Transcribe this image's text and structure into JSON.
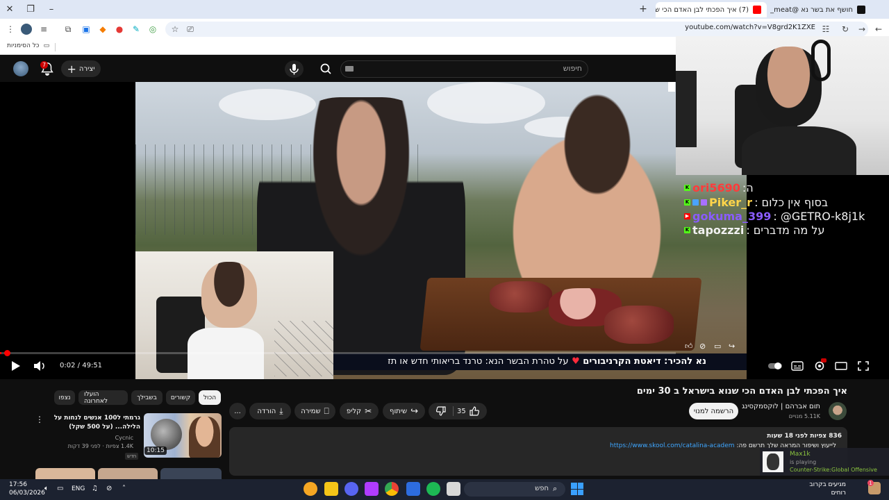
{
  "browser": {
    "tabs": [
      {
        "label": "חושף את בשר נא @meat_",
        "active": false
      },
      {
        "label": "(7) איך הפכתי לבן האדם הכי ש",
        "active": true
      }
    ],
    "new_tab": "+",
    "url": "youtube.com/watch?v=V8grd2K1ZXE",
    "bookmarks_label": "כל הסימניות"
  },
  "youtube": {
    "search_placeholder": "חיפוש",
    "create_label": "יצירה",
    "notifications_count": "7"
  },
  "player": {
    "current_time": "0:02",
    "duration": "49:51",
    "progress": 0.0007,
    "ticker_lead": "נא להכיר: דיאטת הקרניבורים",
    "ticker_sep": "♥",
    "ticker_rest": "על טהרת הבשר הנא: טרנד בריאותי חדש או תז"
  },
  "chat": {
    "rows": [
      {
        "user": "ori5690",
        "text": ":ה",
        "color": "#ff3b3b"
      },
      {
        "user": "Piker_r",
        "text": ": בסוף אין כלום",
        "color": "#ffd54a"
      },
      {
        "user": "gokuma_399",
        "text": ": @GETRO-k8j1k",
        "color": "#8a5cff"
      },
      {
        "user": "tapozzzi",
        "text": ": על מה מדברים",
        "color": "#ffffff"
      }
    ]
  },
  "video": {
    "title": "איך הפכתי לבן האדם הכי שנוא בישראל ב 30 ימים",
    "channel": "תום אברהם | לוקסמקסינג",
    "subscribers": "5.11K מנויים",
    "subscribe_label": "הרשמה למנוי",
    "likes": "35",
    "share_label": "שיתוף",
    "clip_label": "קליפ",
    "save_label": "שמירה",
    "download_label": "הורדה",
    "more_label": "...",
    "description_meta": "836 צפיות  לפני 18 שעות",
    "description_text": "לייעוץ ושיפור המראה שלך תרשם פה:",
    "description_link": "https://www.skool.com/catalina-academ"
  },
  "chips": [
    "הכול",
    "קשורים",
    "בשבילך",
    "הועלו לאחרונה",
    "נצפו"
  ],
  "recommendation": {
    "title": "גרמתי ל100 אנשים לנחות על הלילה... (על 500 שקל)",
    "channel": "Cycnic",
    "meta": "1.4K צפיות · לפני 39 דקות",
    "badge": "חדש",
    "duration": "10:15"
  },
  "notification": {
    "name": "Max1k",
    "status": "is playing",
    "game": "Counter-Strike:Global Offensive"
  },
  "taskbar": {
    "time": "17:56",
    "date": "06/03/2026",
    "lang": "ENG",
    "search_placeholder": "חפש",
    "weather_line1": "מגיעים בקרוב",
    "weather_line2": "רוחים",
    "weather_badge": "1"
  }
}
